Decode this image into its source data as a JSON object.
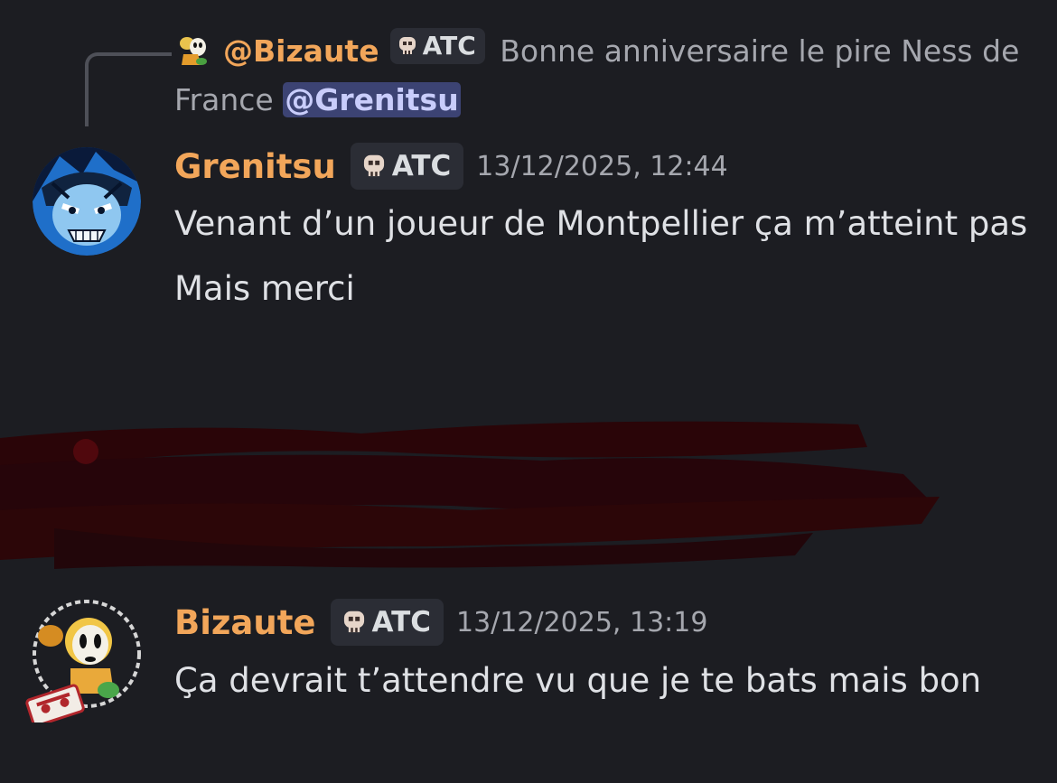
{
  "reply": {
    "author": "@Bizaute",
    "tag": "ATC",
    "text": "Bonne anniversaire le pire Ness de France",
    "mention": "@Grenitsu"
  },
  "messages": [
    {
      "author": "Grenitsu",
      "tag": "ATC",
      "timestamp": "13/12/2025, 12:44",
      "lines": [
        "Venant d’un joueur de Montpellier ça m’atteint pas",
        "Mais merci"
      ]
    },
    {
      "author": "Bizaute",
      "tag": "ATC",
      "timestamp": "13/12/2025, 13:19",
      "lines": [
        "Ça devrait t’attendre vu que je te bats mais bon"
      ]
    }
  ],
  "colors": {
    "background": "#1c1d22",
    "username": "#f2a65a",
    "mention_bg": "#3c4373",
    "censor": "#2a0508"
  },
  "icons": [
    "reply-avatar-icon",
    "skull-icon",
    "avatar"
  ]
}
